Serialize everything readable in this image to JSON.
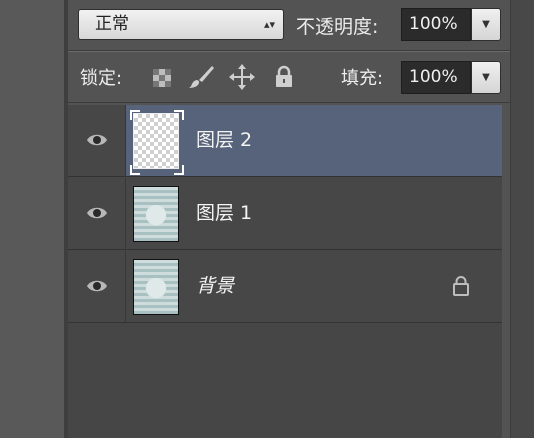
{
  "blend": {
    "mode": "正常",
    "opacity_label": "不透明度:",
    "opacity_value": "100%"
  },
  "lock_row": {
    "label": "锁定:",
    "fill_label": "填充:",
    "fill_value": "100%"
  },
  "layers": [
    {
      "name": "图层 2",
      "selected": true,
      "thumbnail": "transparent"
    },
    {
      "name": "图层 1",
      "selected": false,
      "thumbnail": "photo"
    },
    {
      "name": "背景",
      "selected": false,
      "thumbnail": "photo",
      "locked": true
    }
  ],
  "colors": {
    "panel": "#535353",
    "selected_row": "#56637a",
    "list_bg": "#464646"
  }
}
